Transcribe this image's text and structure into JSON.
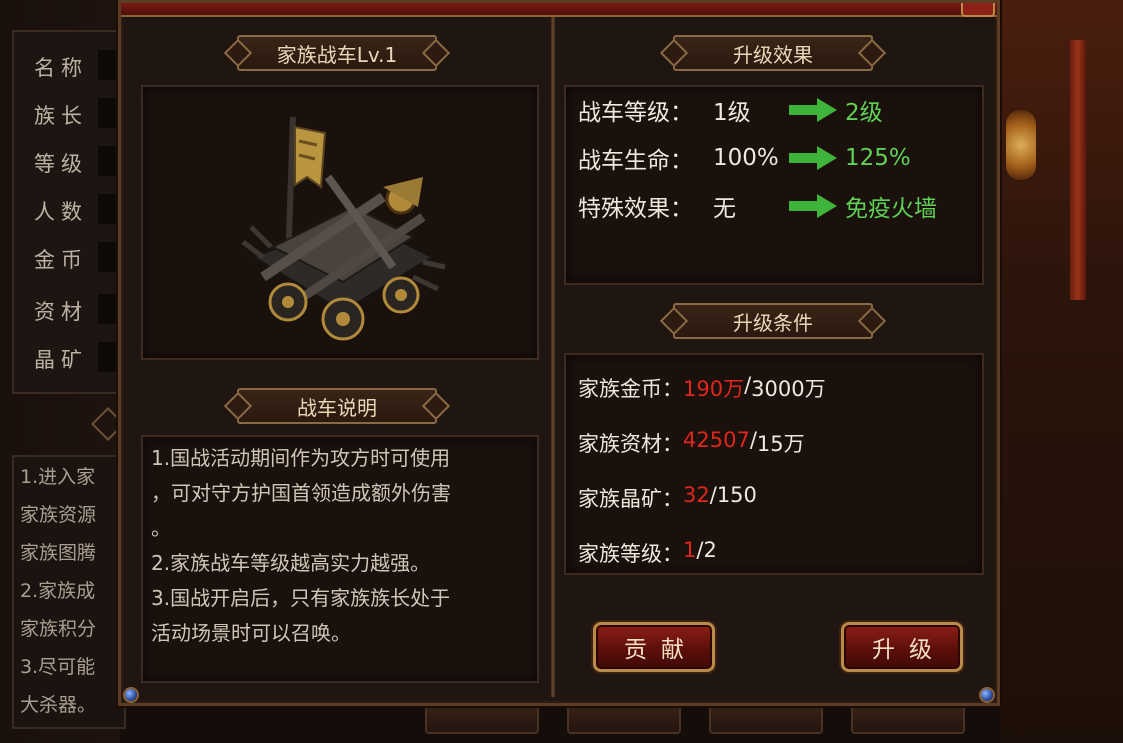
{
  "background": {
    "side_labels": [
      "名称",
      "族长",
      "等级",
      "人数",
      "金币",
      "资材",
      "晶矿"
    ],
    "notes": [
      "1.进入家",
      "家族资源",
      "家族图腾",
      "2.家族成",
      "家族积分",
      "3.尽可能",
      "大杀器。"
    ]
  },
  "left": {
    "chariot_title": "家族战车Lv.1",
    "description_title": "战车说明",
    "description_lines": [
      "1.国战活动期间作为攻方时可使用",
      "，可对守方护国首领造成额外伤害",
      "。",
      "2.家族战车等级越高实力越强。",
      "3.国战开启后，只有家族族长处于",
      "活动场景时可以召唤。"
    ]
  },
  "effects": {
    "title": "升级效果",
    "rows": [
      {
        "label": "战车等级：",
        "from": "1级",
        "to": "2级"
      },
      {
        "label": "战车生命：",
        "from": "100%",
        "to": "125%"
      },
      {
        "label": "特殊效果：",
        "from": "无",
        "to": "免疫火墙"
      }
    ]
  },
  "requirements": {
    "title": "升级条件",
    "rows": [
      {
        "label": "家族金币：",
        "current": "190万",
        "sep": "/",
        "required": "3000万"
      },
      {
        "label": "家族资材：",
        "current": "42507",
        "sep": "/",
        "required": "15万"
      },
      {
        "label": "家族晶矿：",
        "current": "32",
        "sep": "/",
        "required": "150"
      },
      {
        "label": "家族等级：",
        "current": "1",
        "sep": "/",
        "required": "2"
      }
    ]
  },
  "buttons": {
    "contribute": "贡献",
    "upgrade": "升级"
  },
  "colors": {
    "accent_green": "#5fd155",
    "insufficient_red": "#e0261c",
    "frame_gold": "#8a6a44"
  }
}
